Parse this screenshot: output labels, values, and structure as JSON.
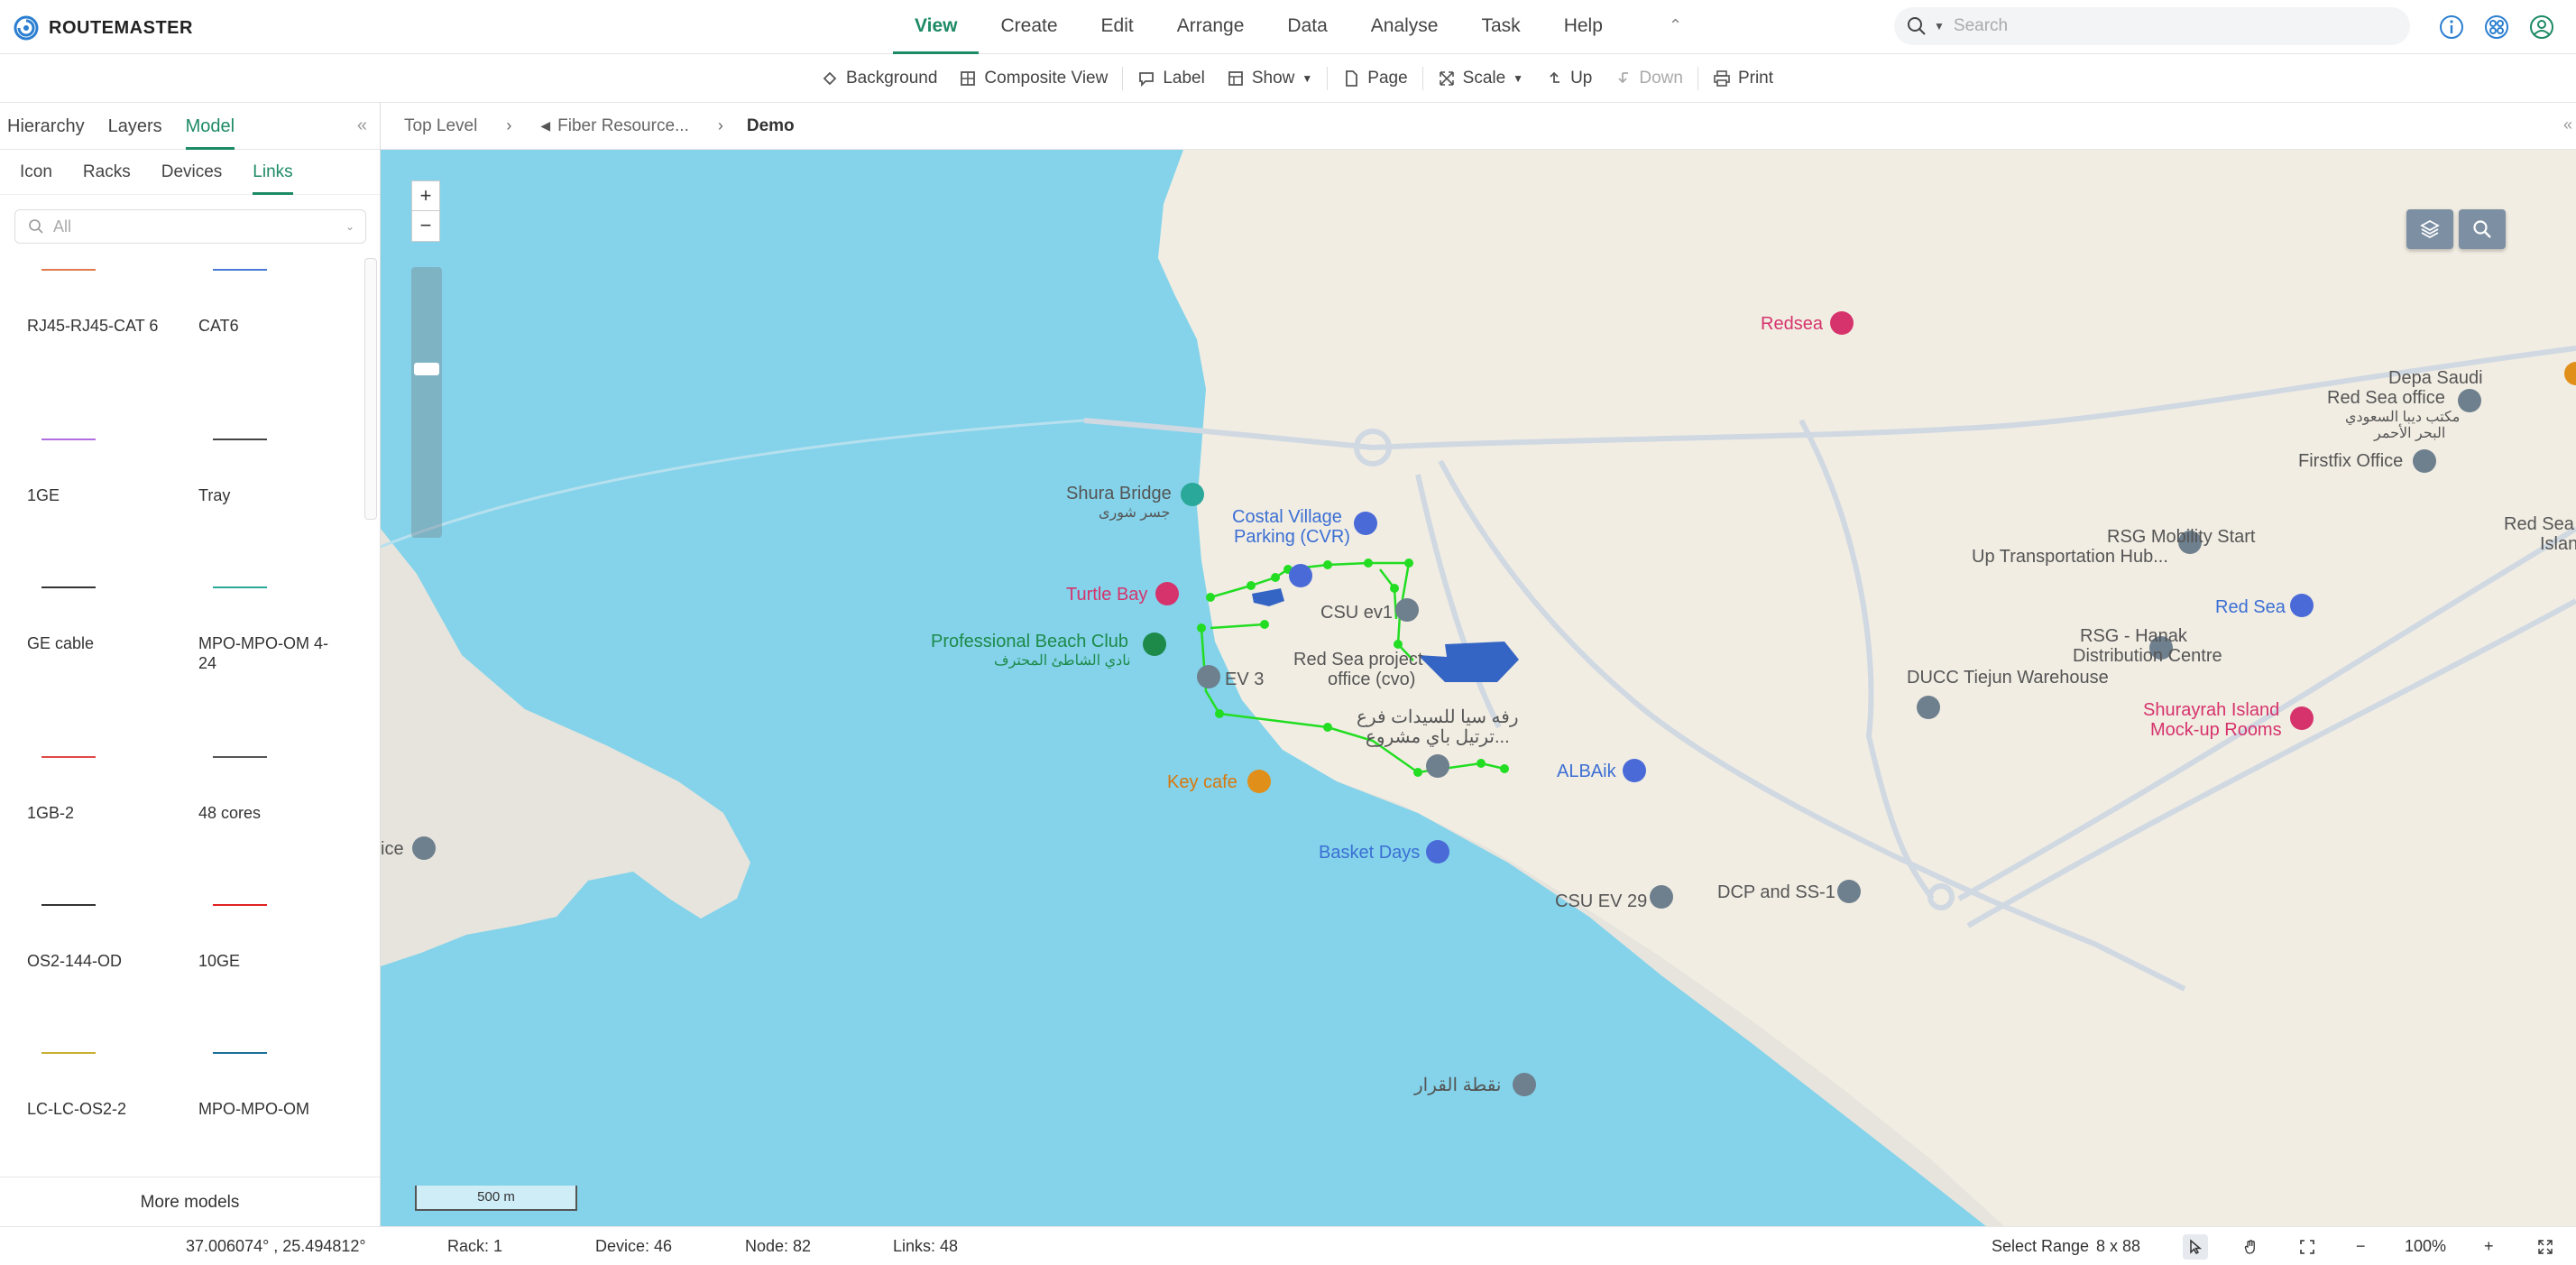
{
  "app": {
    "name": "ROUTEMASTER"
  },
  "menu": [
    "View",
    "Create",
    "Edit",
    "Arrange",
    "Data",
    "Analyse",
    "Task",
    "Help"
  ],
  "search": {
    "placeholder": "Search"
  },
  "toolbar": {
    "background": "Background",
    "composite_view": "Composite View",
    "label": "Label",
    "show": "Show",
    "page": "Page",
    "scale": "Scale",
    "up": "Up",
    "down": "Down",
    "print": "Print"
  },
  "panel": {
    "tabs": [
      "Hierarchy",
      "Layers",
      "Model"
    ],
    "subtabs": [
      "Icon",
      "Racks",
      "Devices",
      "Links"
    ],
    "filter_value": "All",
    "models": [
      {
        "label": "RJ45-RJ45-CAT 6",
        "color": "#e07a4a"
      },
      {
        "label": "CAT6",
        "color": "#4a7ad8"
      },
      {
        "label": "1GE",
        "color": "#b06ee0"
      },
      {
        "label": "Tray",
        "color": "#444444"
      },
      {
        "label": "GE cable",
        "color": "#333333"
      },
      {
        "label": "MPO-MPO-OM 4-24",
        "color": "#2aa89a"
      },
      {
        "label": "1GB-2",
        "color": "#e04848"
      },
      {
        "label": "48 cores",
        "color": "#555555"
      },
      {
        "label": "OS2-144-OD",
        "color": "#333333"
      },
      {
        "label": "10GE",
        "color": "#e02020"
      },
      {
        "label": "LC-LC-OS2-2",
        "color": "#c8b030"
      },
      {
        "label": "MPO-MPO-OM",
        "color": "#1e6f9a"
      }
    ],
    "more_models": "More models"
  },
  "breadcrumb": {
    "top_level": "Top Level",
    "parent": "Fiber Resource...",
    "current": "Demo"
  },
  "map": {
    "scale_label": "500 m",
    "zoom_in": "+",
    "zoom_out": "−",
    "pois": [
      {
        "label": "Redsea",
        "color": "pink"
      },
      {
        "label": "Depa Saudi",
        "color": "gray"
      },
      {
        "label": "Red Sea office",
        "color": "gray"
      },
      {
        "label": "مكتب ديبا السعودي",
        "color": "gray"
      },
      {
        "label": "البحر الأحمر",
        "color": "gray"
      },
      {
        "label": "Firstfix Office",
        "color": "gray"
      },
      {
        "label": "Red Sea",
        "color": "gray"
      },
      {
        "label": "Islan",
        "color": "gray"
      },
      {
        "label": "Shura Bridge",
        "color": "gray"
      },
      {
        "label": "جسر شورى",
        "color": "gray"
      },
      {
        "label": "Costal Village",
        "color": "blue"
      },
      {
        "label": "Parking (CVR)",
        "color": "blue"
      },
      {
        "label": "RSG Mobility Start",
        "color": "gray"
      },
      {
        "label": "Up Transportation Hub...",
        "color": "gray"
      },
      {
        "label": "Turtle Bay",
        "color": "pink"
      },
      {
        "label": "CSU ev1",
        "color": "gray"
      },
      {
        "label": "Red Sea",
        "color": "blue"
      },
      {
        "label": "Professional Beach Club",
        "color": "green"
      },
      {
        "label": "نادي الشاطئ المحترف",
        "color": "green"
      },
      {
        "label": "RSG - Hanak",
        "color": "gray"
      },
      {
        "label": "Distribution Centre",
        "color": "gray"
      },
      {
        "label": "Red Sea project",
        "color": "gray"
      },
      {
        "label": "office (cvo)",
        "color": "gray"
      },
      {
        "label": "EV 3",
        "color": "gray"
      },
      {
        "label": "DUCC Tiejun Warehouse",
        "color": "gray"
      },
      {
        "label": "رفه سيا للسيدات فرع",
        "color": "gray"
      },
      {
        "label": "ترتيل باي مشروع...",
        "color": "gray"
      },
      {
        "label": "Shurayrah Island",
        "color": "pink"
      },
      {
        "label": "Mock-up Rooms",
        "color": "pink"
      },
      {
        "label": "ALBAik",
        "color": "blue"
      },
      {
        "label": "Key cafe",
        "color": "orange"
      },
      {
        "label": "ice",
        "color": "gray"
      },
      {
        "label": "Basket Days",
        "color": "blue"
      },
      {
        "label": "CSU EV 29",
        "color": "gray"
      },
      {
        "label": "DCP and SS-1",
        "color": "gray"
      },
      {
        "label": "نقطة القرار",
        "color": "gray"
      }
    ]
  },
  "status": {
    "coords": "37.006074° , 25.494812°",
    "rack": "Rack: 1",
    "device": "Device: 46",
    "node": "Node: 82",
    "links": "Links: 48",
    "select_range": "Select Range",
    "range_value": "8 x 88",
    "zoom": "100%",
    "zoom_out": "−",
    "zoom_in": "+"
  },
  "colors": {
    "accent": "#1d8a66",
    "water": "#84d3ea",
    "land": "#f1ede3",
    "link": "#22dd22"
  }
}
